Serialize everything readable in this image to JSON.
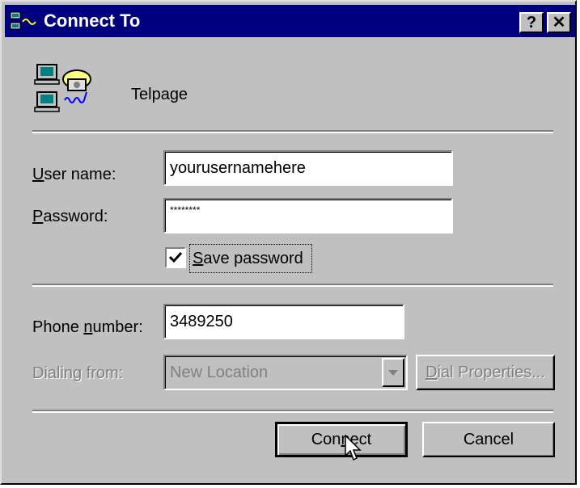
{
  "window": {
    "title": "Connect To",
    "help_label": "?",
    "close_label": "✕"
  },
  "connection": {
    "name": "Telpage",
    "icon": "dial-up-networking-icon"
  },
  "username": {
    "label_first": "U",
    "label_rest": "ser name:",
    "value": "yourusernamehere"
  },
  "password": {
    "label_first": "P",
    "label_rest": "assword:",
    "value": "********"
  },
  "save_password": {
    "label_first": "S",
    "label_rest": "ave password",
    "checked": true
  },
  "phone": {
    "label_pre": "Phone ",
    "label_ul": "n",
    "label_post": "umber:",
    "value": "3489250"
  },
  "dialing_from": {
    "label": "Dialing from:",
    "value": "New Location"
  },
  "dial_properties": {
    "label_first": "D",
    "label_rest": "ial Properties..."
  },
  "connect_button": {
    "label_pre": "Con",
    "label_ul": "n",
    "label_post": "ect"
  },
  "cancel_button": {
    "label": "Cancel"
  }
}
